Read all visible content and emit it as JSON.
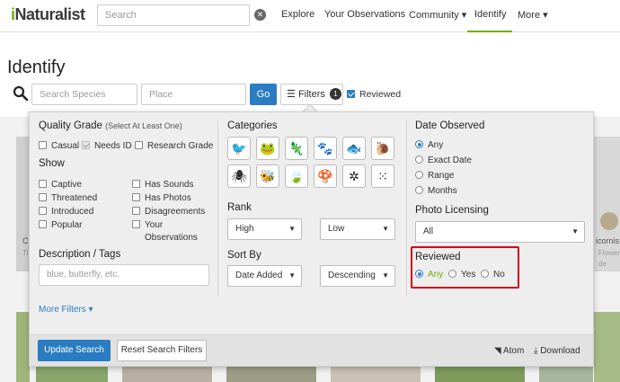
{
  "nav": {
    "logo_i": "i",
    "logo_rest": "Naturalist",
    "search_placeholder": "Search",
    "clear_glyph": "✕",
    "links": [
      {
        "label": "Explore"
      },
      {
        "label": "Your Observations"
      },
      {
        "label": "Community"
      },
      {
        "label": "Identify"
      },
      {
        "label": "More"
      }
    ],
    "dropdown_glyph": "▾"
  },
  "page": {
    "title": "Identify",
    "species_placeholder": "Search Species",
    "place_placeholder": "Place",
    "go_label": "Go",
    "filters_label": "Filters",
    "filters_count": "1",
    "reviewed_label": "Reviewed"
  },
  "filters": {
    "quality_grade": {
      "title": "Quality Grade",
      "hint": "(Select At Least One)",
      "options": [
        {
          "label": "Casual",
          "checked": false
        },
        {
          "label": "Needs ID",
          "checked": true
        },
        {
          "label": "Research Grade",
          "checked": false
        }
      ]
    },
    "show": {
      "title": "Show",
      "left": [
        "Captive",
        "Threatened",
        "Introduced",
        "Popular"
      ],
      "right": [
        "Has Sounds",
        "Has Photos",
        "Disagreements",
        "Your",
        "Observations"
      ]
    },
    "description": {
      "title": "Description / Tags",
      "placeholder": "blue, butterfly, etc."
    },
    "more_filters": "More Filters ▾",
    "categories": {
      "title": "Categories",
      "icons": [
        {
          "name": "birds-icon",
          "glyph": "🐦"
        },
        {
          "name": "amphibians-icon",
          "glyph": "🐸"
        },
        {
          "name": "reptiles-icon",
          "glyph": "🦎"
        },
        {
          "name": "mammals-icon",
          "glyph": "🐾"
        },
        {
          "name": "fish-icon",
          "glyph": "🐟"
        },
        {
          "name": "mollusks-icon",
          "glyph": "🐌"
        },
        {
          "name": "arachnids-icon",
          "glyph": "🕷"
        },
        {
          "name": "insects-icon",
          "glyph": "🐝"
        },
        {
          "name": "plants-icon",
          "glyph": "🍃"
        },
        {
          "name": "fungi-icon",
          "glyph": "🍄"
        },
        {
          "name": "protozoans-icon",
          "glyph": "✲"
        },
        {
          "name": "unknown-icon",
          "glyph": "⁙"
        }
      ]
    },
    "rank": {
      "title": "Rank",
      "high": "High",
      "low": "Low"
    },
    "sort_by": {
      "title": "Sort By",
      "field": "Date Added",
      "order": "Descending"
    },
    "date_observed": {
      "title": "Date Observed",
      "options": [
        {
          "label": "Any",
          "checked": true
        },
        {
          "label": "Exact Date",
          "checked": false
        },
        {
          "label": "Range",
          "checked": false
        },
        {
          "label": "Months",
          "checked": false
        }
      ]
    },
    "photo_licensing": {
      "title": "Photo Licensing",
      "value": "All"
    },
    "reviewed": {
      "title": "Reviewed",
      "any": "Any",
      "yes": "Yes",
      "no": "No",
      "selected": "Any"
    },
    "footer": {
      "update": "Update Search",
      "reset": "Reset Search Filters",
      "atom": "Atom",
      "download": "Download"
    }
  },
  "background": {
    "card_right_text": "icornis",
    "card_right_sub": "Flower",
    "card_right_sub2": "de",
    "card_left_letter": "C",
    "card_left_sub": "Ti"
  },
  "colors": {
    "brand_green": "#74ac00",
    "primary_blue": "#2a7dc2",
    "highlight_red": "#d0021b"
  }
}
